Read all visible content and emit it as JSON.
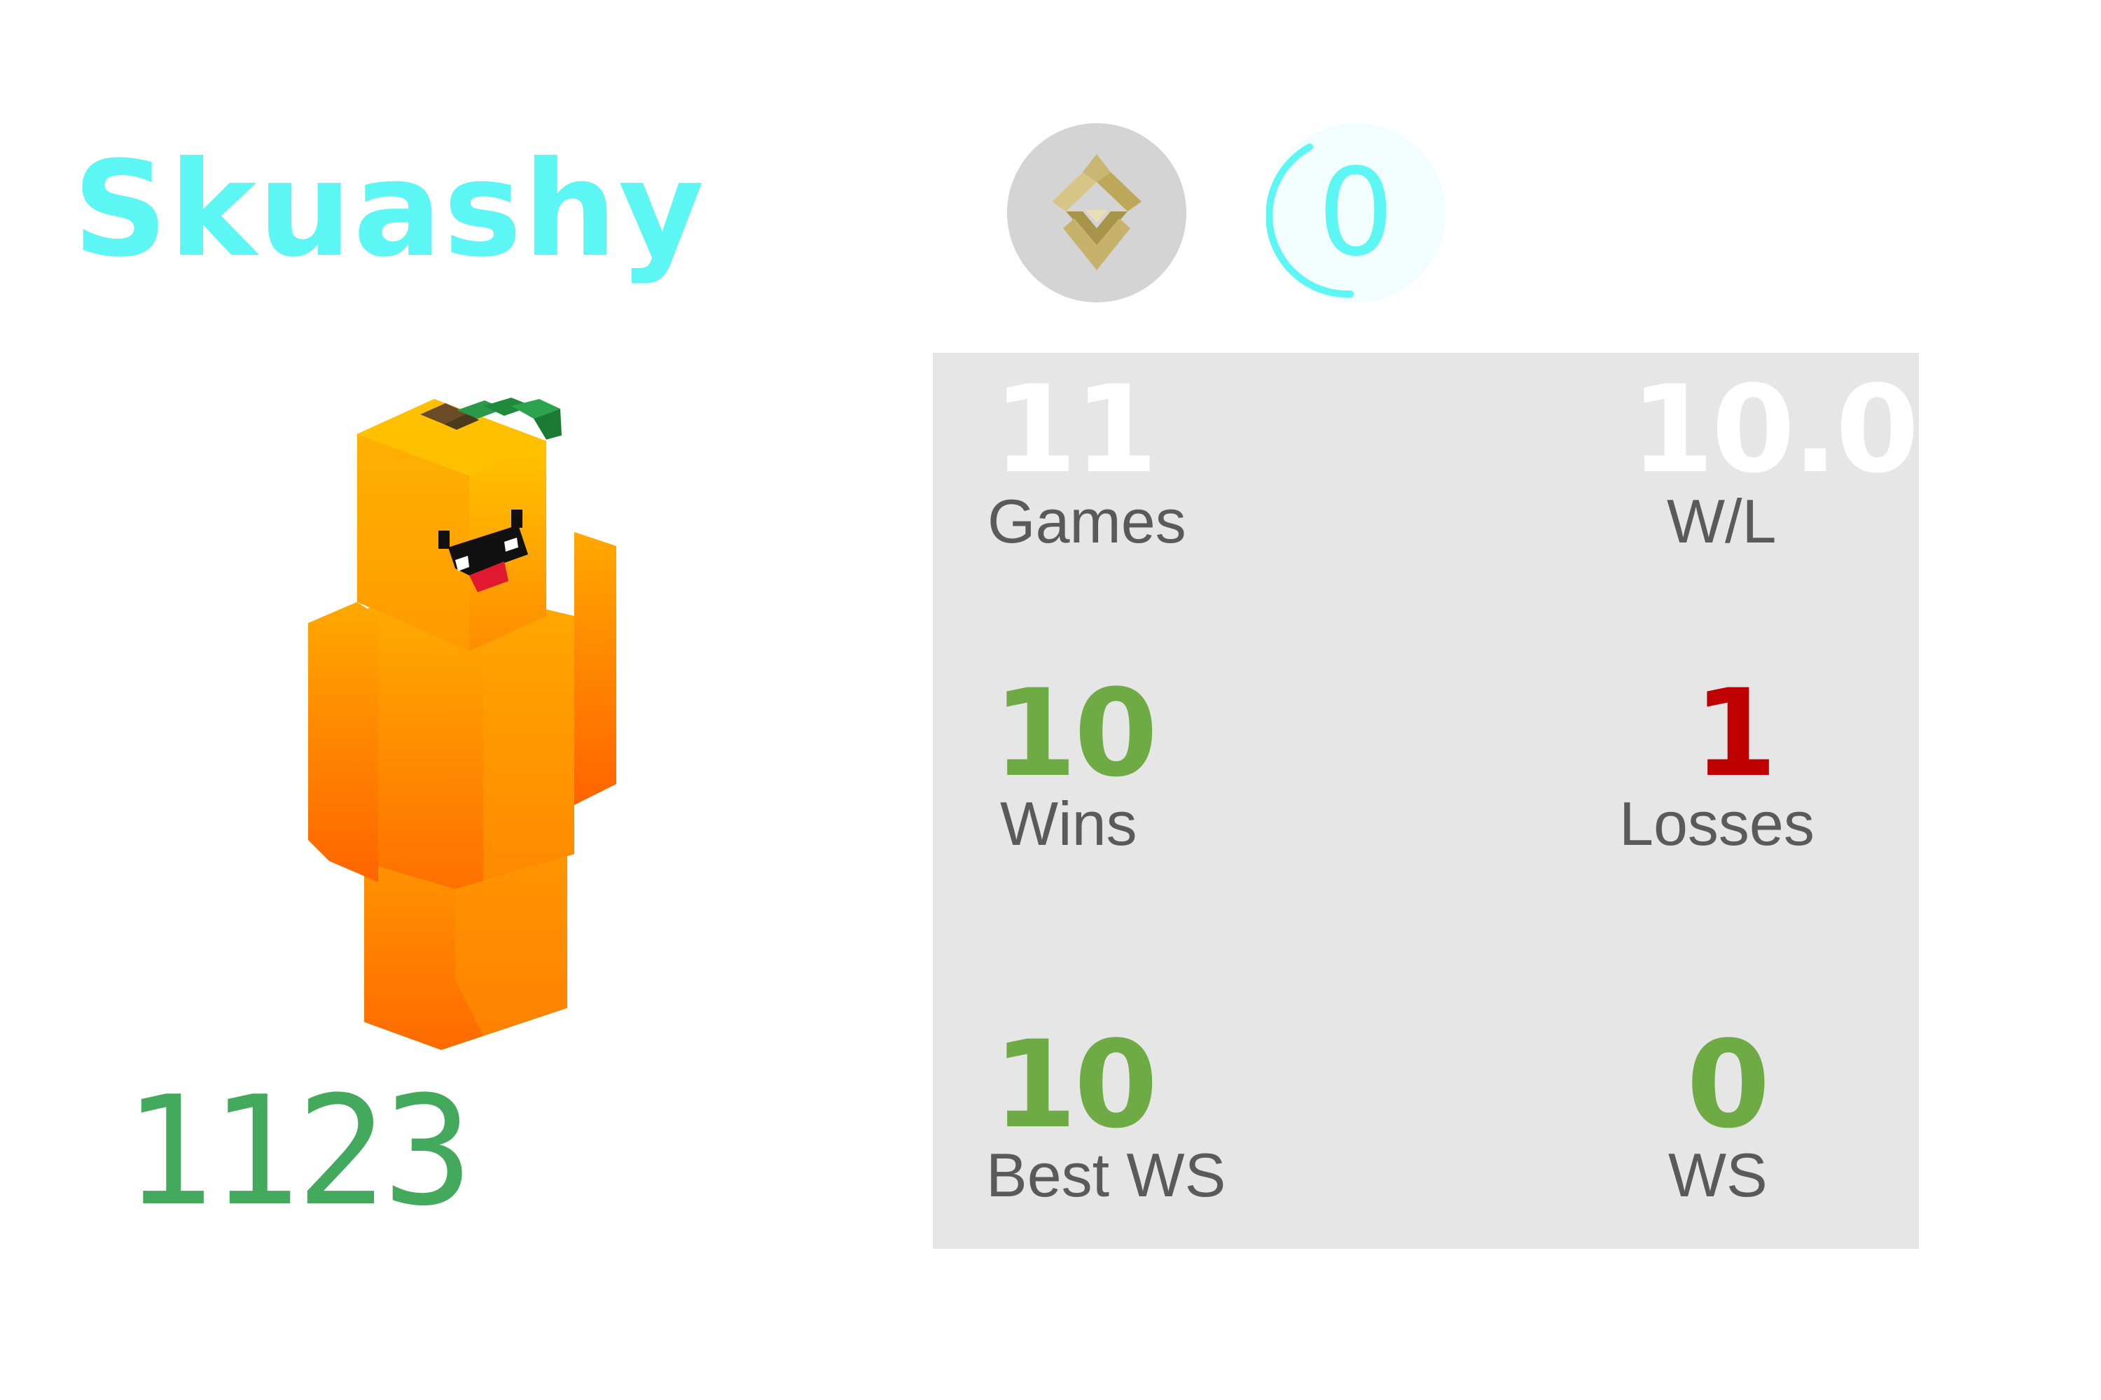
{
  "player": {
    "name": "Skuashy",
    "rating": "1123"
  },
  "badges": {
    "level": "0",
    "rank_icon": "rank-emblem-icon"
  },
  "stats": {
    "games": {
      "value": "11",
      "label": "Games"
    },
    "wl": {
      "value": "10.00",
      "label": "W/L"
    },
    "wins": {
      "value": "10",
      "label": "Wins"
    },
    "losses": {
      "value": "1",
      "label": "Losses"
    },
    "best_ws": {
      "value": "10",
      "label": "Best WS"
    },
    "ws": {
      "value": "0",
      "label": "WS"
    }
  },
  "colors": {
    "name": "#5cf7f5",
    "rating": "#43a95d",
    "wins": "#6fab45",
    "losses": "#c00000",
    "panel": "#e6e6e6",
    "label": "#5a5a5a"
  }
}
